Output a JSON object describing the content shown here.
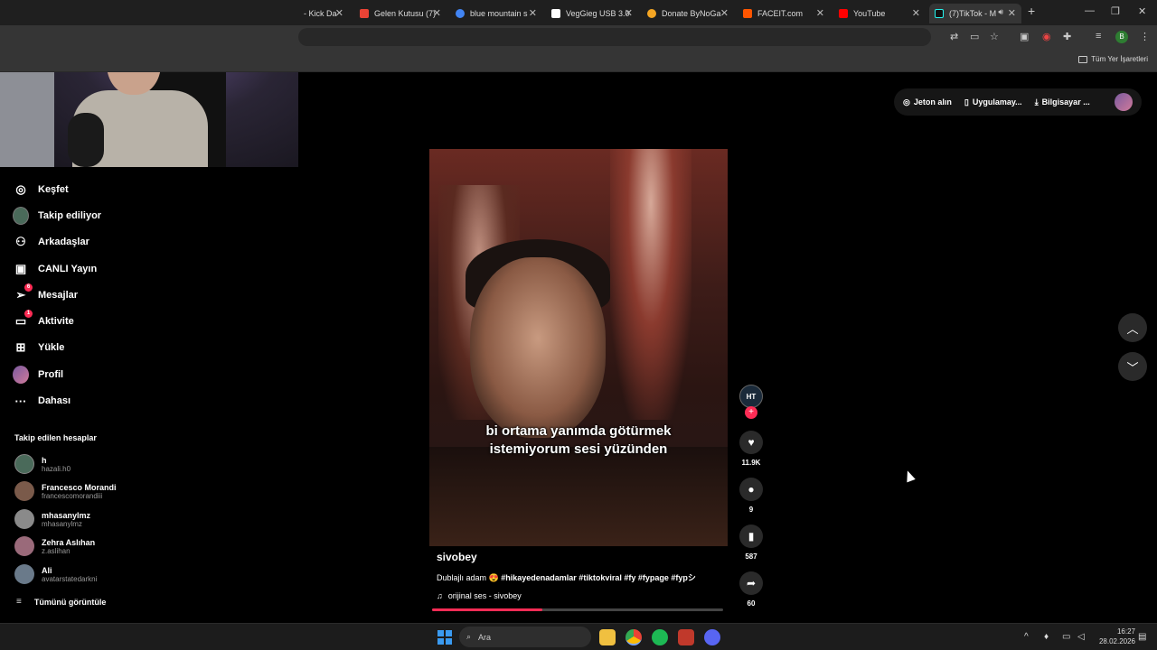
{
  "browser": {
    "tabs": [
      {
        "title": "- Kick Da",
        "color": "#53fc18"
      },
      {
        "title": "Gelen Kutusu (7)",
        "color": "#ea4335"
      },
      {
        "title": "blue mountain s",
        "color": "#4285f4"
      },
      {
        "title": "VegGieg USB 3.0",
        "color": "#ffffff"
      },
      {
        "title": "Donate ByNoGa",
        "color": "#f5a623"
      },
      {
        "title": "FACEIT.com",
        "color": "#ff5500"
      },
      {
        "title": "YouTube",
        "color": "#ff0000"
      },
      {
        "title": "(7)TikTok - M",
        "color": "#25f4ee"
      }
    ],
    "bookmarks_all": "Tüm Yer İşaretleri",
    "profile_initial": "B"
  },
  "sidebar": {
    "items": [
      {
        "label": "Keşfet",
        "icon": "compass-icon",
        "glyph": "◎"
      },
      {
        "label": "Takip ediliyor",
        "icon": "following-avatar-icon",
        "glyph": ""
      },
      {
        "label": "Arkadaşlar",
        "icon": "friends-icon",
        "glyph": "⚇"
      },
      {
        "label": "CANLI Yayın",
        "icon": "live-tv-icon",
        "glyph": "▣"
      },
      {
        "label": "Mesajlar",
        "icon": "messages-icon",
        "glyph": "➢",
        "badge": "6"
      },
      {
        "label": "Aktivite",
        "icon": "activity-icon",
        "glyph": "▭",
        "badge": "1"
      },
      {
        "label": "Yükle",
        "icon": "upload-icon",
        "glyph": "⊞"
      },
      {
        "label": "Profil",
        "icon": "profile-avatar-icon",
        "glyph": ""
      },
      {
        "label": "Dahası",
        "icon": "more-icon",
        "glyph": "···"
      }
    ],
    "following_title": "Takip edilen hesaplar",
    "accounts": [
      {
        "name": "h",
        "username": "hazali.h0",
        "color": "#4a6a5a"
      },
      {
        "name": "Francesco Morandi",
        "username": "francescomorandiii",
        "color": "#7a5a4a"
      },
      {
        "name": "mhasanylmz",
        "username": "mhasanylmz",
        "color": "#8a8a8a"
      },
      {
        "name": "Zehra Aslıhan",
        "username": "z.aslihan",
        "color": "#9a6a7a"
      },
      {
        "name": "Ali",
        "username": "avatarstatedarkni",
        "color": "#6a7a8a"
      }
    ],
    "see_all": "Tümünü görüntüle"
  },
  "top_actions": {
    "coins": "Jeton alın",
    "app": "Uygulamay...",
    "desktop": "Bilgisayar ..."
  },
  "video": {
    "caption_line1": "bi ortama yanımda götürmek",
    "caption_line2": "istemiyorum sesi yüzünden",
    "author": "sivobey",
    "desc_prefix": "Dublajlı adam 😍",
    "desc_tags": "#hikayedenadamlar #tiktokviral #fy #fypage #fypシ",
    "music": "orijinal ses - sivobey",
    "progress": 0.38,
    "author_avatar_text": "HT"
  },
  "actions": {
    "likes": "11.9K",
    "comments": "9",
    "saves": "587",
    "shares": "60"
  },
  "taskbar": {
    "search_placeholder": "Ara",
    "time": "16:27",
    "date": "28.02.2026"
  }
}
